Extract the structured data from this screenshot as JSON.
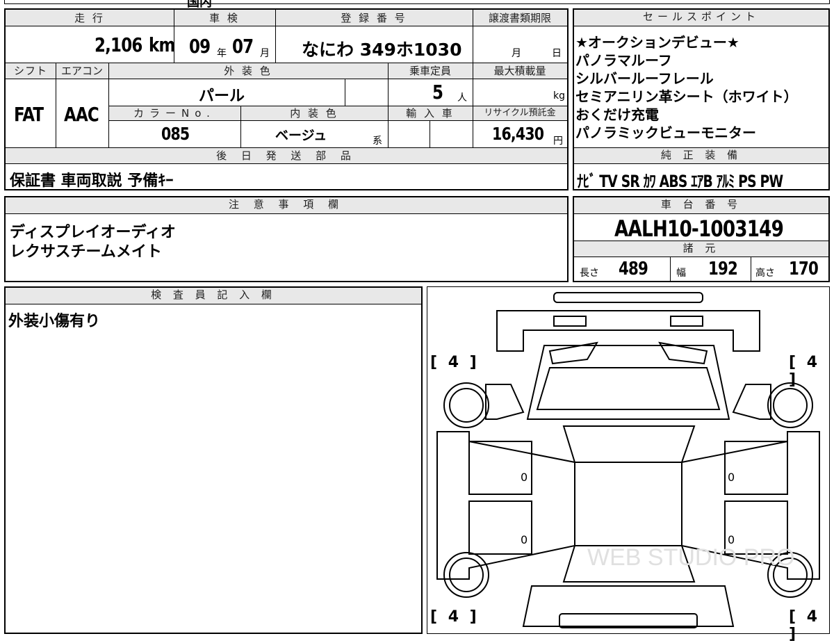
{
  "top_strip": {
    "text_partial": "国内"
  },
  "headers": {
    "mileage": "走 行",
    "inspection": "車 検",
    "registration": "登 録 番 号",
    "transfer_deadline": "譲渡書類期限",
    "sales_points": "セールスポイント",
    "shift": "シフト",
    "aircon": "エアコン",
    "exterior_color": "外 装 色",
    "capacity": "乗車定員",
    "max_load": "最大積載量",
    "color_no": "カラーNo.",
    "interior_color": "内 装 色",
    "import": "輸 入 車",
    "recycle": "リサイクル預託金",
    "later_parts": "後 日 発 送 部 品",
    "genuine_equipment": "純 正 装 備",
    "notes": "注 意 事 項 欄",
    "chassis_no": "車 台 番 号",
    "specs": "諸 元",
    "inspector": "検 査 員 記 入 欄"
  },
  "mileage": {
    "value": "2,106",
    "unit": "km"
  },
  "inspection": {
    "year": "09",
    "year_unit": "年",
    "month": "07",
    "month_unit": "月"
  },
  "registration": {
    "value": "なにわ 349ホ1030"
  },
  "transfer_deadline": {
    "month_unit": "月",
    "day_unit": "日"
  },
  "shift": {
    "value": "FAT"
  },
  "aircon": {
    "value": "AAC"
  },
  "exterior_color": {
    "value": "パール"
  },
  "capacity": {
    "value": "5",
    "unit": "人"
  },
  "max_load": {
    "unit": "kg"
  },
  "color_no": {
    "value": "085"
  },
  "interior_color": {
    "value": "ベージュ",
    "suffix": "系"
  },
  "recycle": {
    "value": "16,430",
    "unit": "円"
  },
  "sales_points": [
    "★オークションデビュー★",
    "パノラマルーフ",
    "シルバールーフレール",
    "セミアニリン革シート（ホワイト）",
    "おくだけ充電",
    "パノラミックビューモニター"
  ],
  "later_parts": {
    "value": "保証書 車両取説 予備ｷｰ"
  },
  "genuine_equipment": {
    "value": "ﾅﾋﾞ TV SR ｶﾜ ABS ｴｱB ｱﾙﾐ PS PW"
  },
  "notes": {
    "line1": "ディスプレイオーディオ",
    "line2": "レクサスチームメイト"
  },
  "chassis_no": {
    "value": "AALH10-1003149"
  },
  "specs": {
    "length_label": "長さ",
    "length": "489",
    "width_label": "幅",
    "width": "192",
    "height_label": "高さ",
    "height": "170"
  },
  "inspector": {
    "comment": "外装小傷有り"
  },
  "diagram": {
    "tire_front_left": "[ 4 ]",
    "tire_front_right": "[ 4 ]",
    "tire_rear_left": "[ 4 ]",
    "tire_rear_right": "[ 4 ]",
    "door_mark_1": "0",
    "door_mark_2": "0",
    "door_mark_3": "0",
    "door_mark_4": "0",
    "watermark": "WEB STUDIO PRO"
  }
}
